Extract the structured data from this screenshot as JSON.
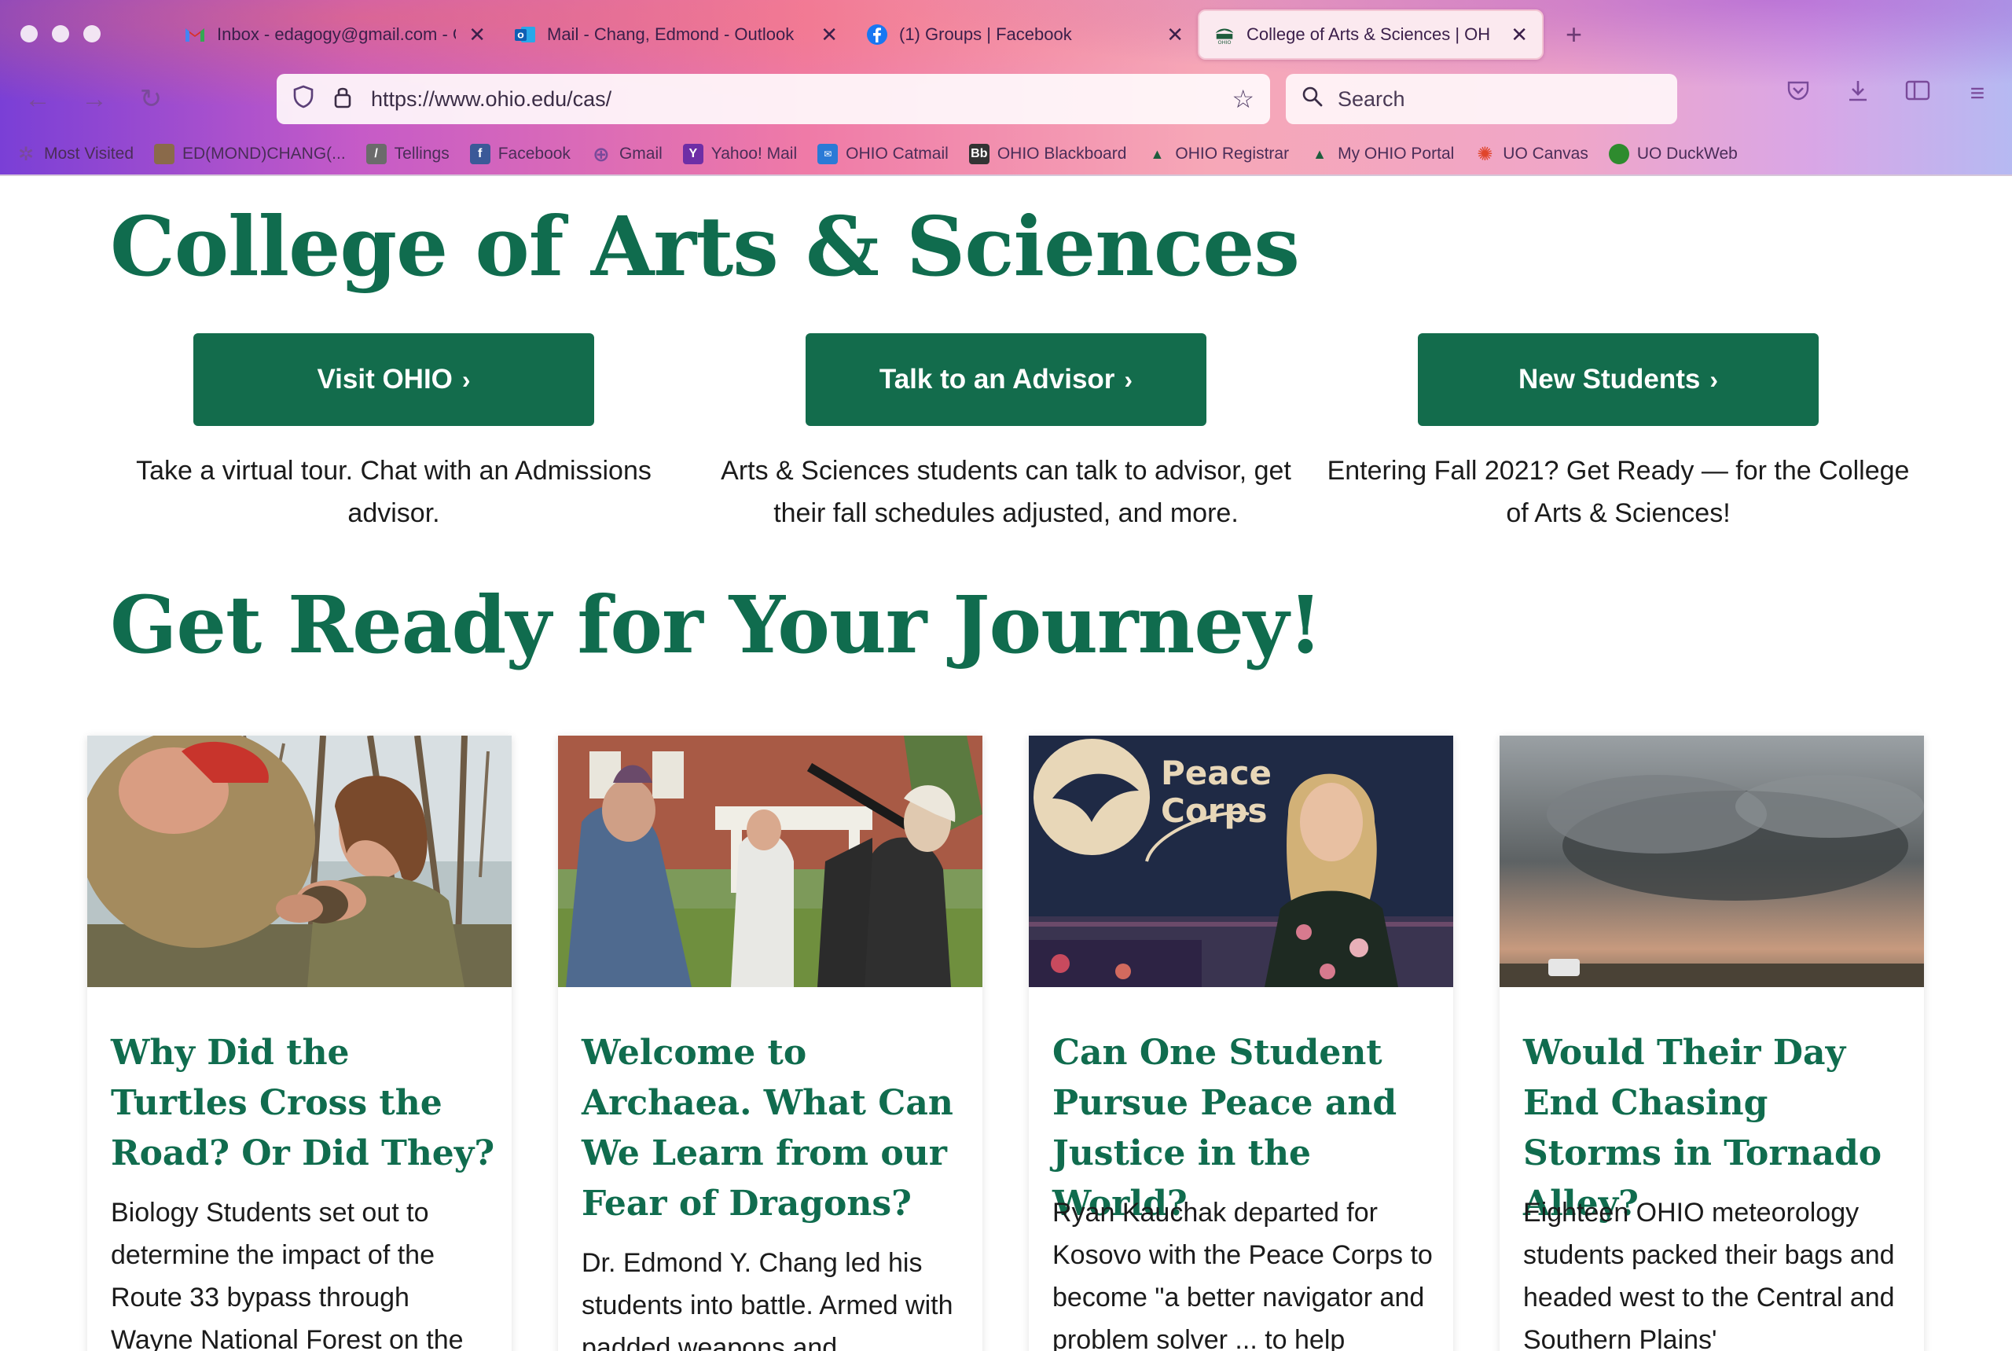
{
  "browser": {
    "tabs": [
      {
        "label": "Inbox - edagogy@gmail.com - G",
        "icon": "gmail-icon"
      },
      {
        "label": "Mail - Chang, Edmond - Outlook",
        "icon": "outlook-icon"
      },
      {
        "label": "(1) Groups | Facebook",
        "icon": "facebook-icon"
      },
      {
        "label": "College of Arts & Sciences | OH",
        "icon": "ohio-icon"
      }
    ],
    "url": "https://www.ohio.edu/cas/",
    "search_placeholder": "Search",
    "bookmarks": [
      {
        "label": "Most Visited"
      },
      {
        "label": "ED(MOND)CHANG(..."
      },
      {
        "label": "Tellings"
      },
      {
        "label": "Facebook"
      },
      {
        "label": "Gmail"
      },
      {
        "label": "Yahoo! Mail"
      },
      {
        "label": "OHIO Catmail"
      },
      {
        "label": "OHIO Blackboard"
      },
      {
        "label": "OHIO Registrar"
      },
      {
        "label": "My OHIO Portal"
      },
      {
        "label": "UO Canvas"
      },
      {
        "label": "UO DuckWeb"
      }
    ]
  },
  "page": {
    "title": "College of Arts & Sciences",
    "ctas": [
      {
        "label": "Visit OHIO",
        "desc": "Take a virtual tour. Chat with an Admissions advisor."
      },
      {
        "label": "Talk to an Advisor",
        "desc": "Arts & Sciences students can talk to advisor, get their fall schedules adjusted, and more."
      },
      {
        "label": "New Students",
        "desc": "Entering Fall 2021? Get Ready — for the College of Arts & Sciences!"
      }
    ],
    "section_title": "Get Ready for Your Journey!",
    "cards": [
      {
        "title": "Why Did the Turtles Cross the Road? Or Did They?",
        "body": "Biology Students set out to determine the impact of the Route 33 bypass through Wayne National Forest on the"
      },
      {
        "title": "Welcome to Archaea. What Can We Learn from our Fear of Dragons?",
        "body": "Dr. Edmond Y. Chang led his students into battle. Armed with padded weapons and"
      },
      {
        "title": "Can One Student Pursue Peace and Justice in the World?",
        "body": "Ryan Kauchak departed for Kosovo with the Peace Corps to become \"a better navigator and problem solver ... to help",
        "photo_text": "Peace Corps"
      },
      {
        "title": "Would Their Day End Chasing Storms in Tornado Alley?",
        "body": "Eighteen OHIO meteorology students packed their bags and headed west to the Central and Southern Plains'"
      }
    ]
  },
  "colors": {
    "brand_green": "#106c4e",
    "button_green": "#136c4c"
  }
}
